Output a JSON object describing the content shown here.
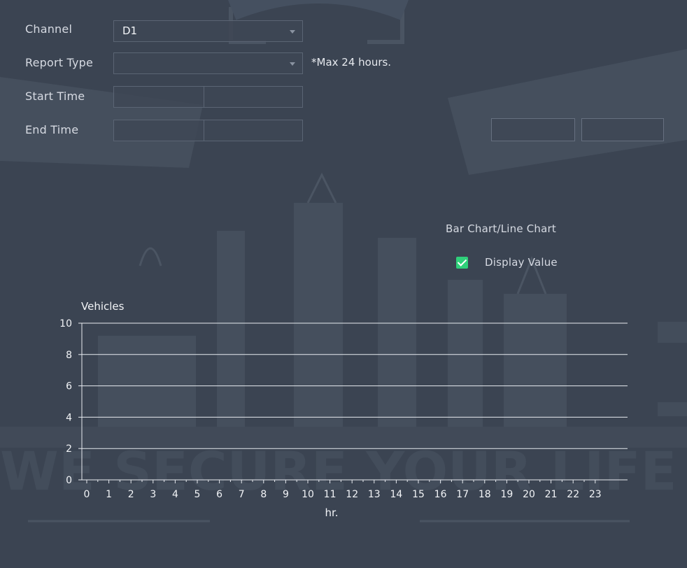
{
  "form": {
    "channel_label": "Channel",
    "channel_value": "D1",
    "report_type_label": "Report Type",
    "report_type_value": "",
    "max_note": "*Max 24 hours.",
    "start_time_label": "Start Time",
    "end_time_label": "End Time"
  },
  "options": {
    "chart_toggle_label": "Bar Chart/Line Chart",
    "display_value_label": "Display Value",
    "display_value_checked": true
  },
  "colors": {
    "background": "#3b4452",
    "checkbox": "#2fd07a",
    "grid": "#e8ebf0"
  },
  "chart_data": {
    "type": "bar",
    "ylabel": "Vehicles",
    "xlabel": "hr.",
    "categories": [
      "0",
      "1",
      "2",
      "3",
      "4",
      "5",
      "6",
      "7",
      "8",
      "9",
      "10",
      "11",
      "12",
      "13",
      "14",
      "15",
      "16",
      "17",
      "18",
      "19",
      "20",
      "21",
      "22",
      "23"
    ],
    "values": [
      0,
      0,
      0,
      0,
      0,
      0,
      0,
      0,
      0,
      0,
      0,
      0,
      0,
      0,
      0,
      0,
      0,
      0,
      0,
      0,
      0,
      0,
      0,
      0
    ],
    "yticks": [
      0,
      2,
      4,
      6,
      8,
      10
    ],
    "ylim": [
      0,
      10
    ],
    "grid": true
  }
}
